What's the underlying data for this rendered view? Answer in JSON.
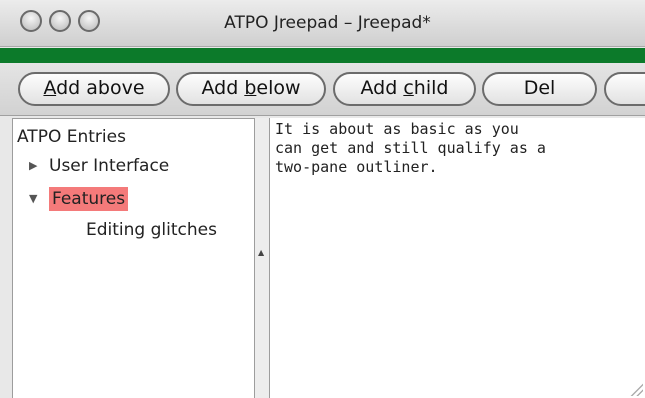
{
  "window": {
    "title": "ATPO Jreepad – Jreepad*"
  },
  "toolbar": {
    "buttons": [
      {
        "label": "Add above",
        "mnemonic": "A"
      },
      {
        "label": "Add below",
        "mnemonic": "b"
      },
      {
        "label": "Add child",
        "mnemonic": "c"
      },
      {
        "label": "Del"
      }
    ]
  },
  "tree": {
    "root": "ATPO Entries",
    "items": [
      {
        "label": "User Interface",
        "expanded": false
      },
      {
        "label": "Features",
        "expanded": true,
        "selected": true
      },
      {
        "label": "Editing glitches"
      }
    ]
  },
  "editor": {
    "lines": [
      "It is about as basic as you",
      "can get and still qualify as a",
      "two-pane outliner."
    ]
  },
  "colors": {
    "accent_bar": "#0c7a2a",
    "selection": "#f47a7a"
  }
}
